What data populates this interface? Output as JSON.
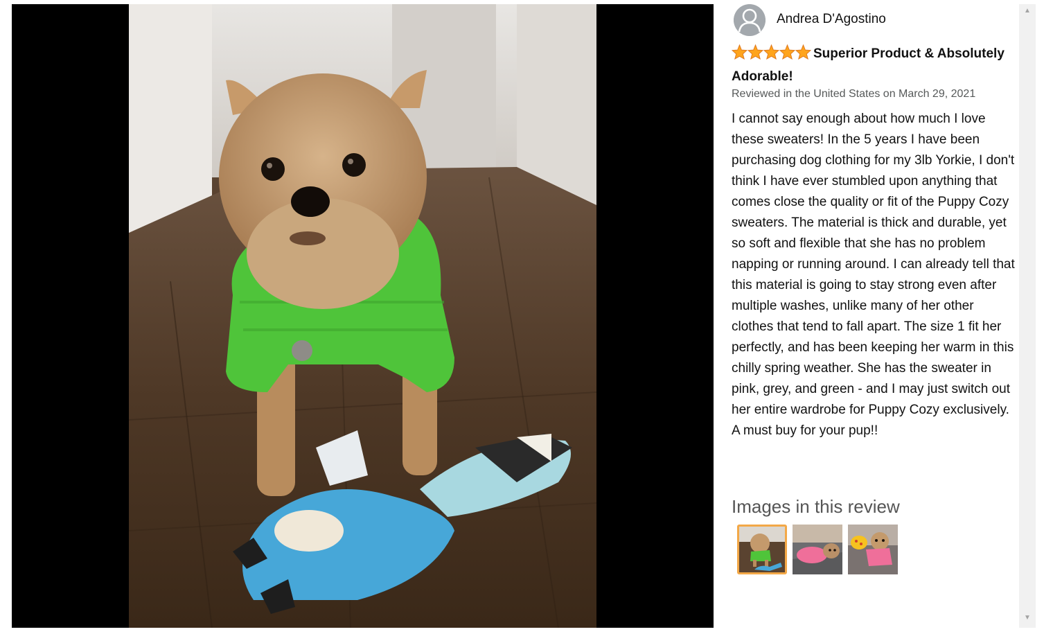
{
  "review": {
    "author": "Andrea D'Agostino",
    "rating": 5,
    "rating_max": 5,
    "title": "Superior Product & Absolutely Adorable!",
    "date_line": "Reviewed in the United States on March 29, 2021",
    "body": "I cannot say enough about how much I love these sweaters! In the 5 years I have been purchasing dog clothing for my 3lb Yorkie, I don't think I have ever stumbled upon anything that comes close the quality or fit of the Puppy Cozy sweaters. The material is thick and durable, yet so soft and flexible that she has no problem napping or running around. I can already tell that this material is going to stay strong even after multiple washes, unlike many of her other clothes that tend to fall apart. The size 1 fit her perfectly, and has been keeping her warm in this chilly spring weather. She has the sweater in pink, grey, and green - and I may just switch out her entire wardrobe for Puppy Cozy exclusively. A must buy for your pup!!"
  },
  "images_section": {
    "heading": "Images in this review",
    "selected_index": 0,
    "thumbnails": [
      {
        "name": "green-sweater-photo"
      },
      {
        "name": "pink-sweater-lying-photo"
      },
      {
        "name": "pink-sweater-toy-photo"
      }
    ]
  },
  "colors": {
    "star": "#ffa41c",
    "selected_border": "#f3a847",
    "date_gray": "#565959",
    "viewer_bg": "#000000"
  },
  "icons": {
    "avatar": "person-silhouette-icon",
    "star": "star-icon",
    "scroll_up": "triangle-up-icon",
    "scroll_down": "triangle-down-icon"
  }
}
